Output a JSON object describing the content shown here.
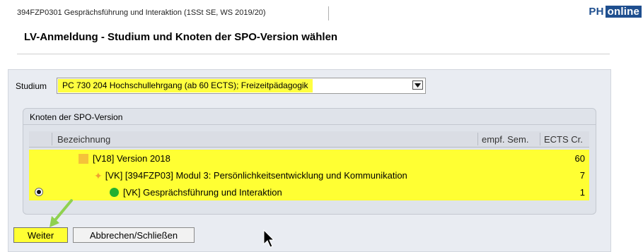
{
  "header": {
    "course_info": "394FZP0301 Gesprächsführung und Interaktion (1SSt SE, WS 2019/20)",
    "logo_ph": "PH",
    "logo_online": "online"
  },
  "page": {
    "title": "LV-Anmeldung - Studium und Knoten der SPO-Version wählen"
  },
  "studium": {
    "label": "Studium",
    "selected": "PC 730 204 Hochschullehrgang (ab 60 ECTS); Freizeitpädagogik"
  },
  "knoten": {
    "legend": "Knoten der SPO-Version",
    "columns": {
      "bezeichnung": "Bezeichnung",
      "empf_sem": "empf. Sem.",
      "ects": "ECTS Cr."
    },
    "rows": [
      {
        "label": "[V18] Version 2018",
        "ects": "60",
        "icon": "square-node-icon",
        "selected": false
      },
      {
        "label": "[VK] [394FZP03] Modul 3: Persönlichkeitsentwicklung und Kommunikation",
        "ects": "7",
        "icon": "diamond-node-icon",
        "selected": false
      },
      {
        "label": "[VK] Gesprächsführung und Interaktion",
        "ects": "1",
        "icon": "circle-node-icon",
        "selected": true
      }
    ]
  },
  "buttons": {
    "weiter": "Weiter",
    "abbrechen": "Abbrechen/Schließen"
  },
  "colors": {
    "highlight": "#ffff33",
    "panel_bg": "#e9ecf2",
    "logo_blue": "#1f4f8f",
    "arrow_green": "#8fd14f"
  }
}
